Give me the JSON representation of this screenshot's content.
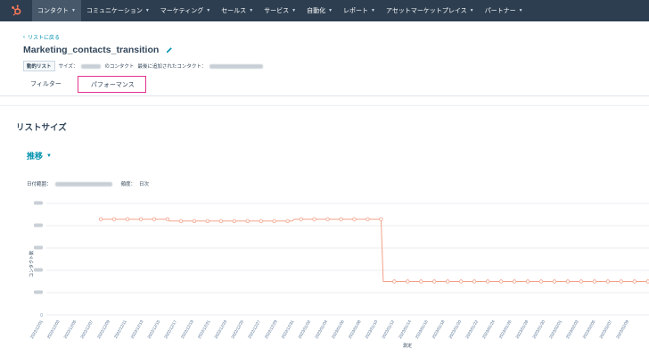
{
  "nav": {
    "items": [
      {
        "label": "コンタクト",
        "active": true
      },
      {
        "label": "コミュニケーション",
        "active": false
      },
      {
        "label": "マーケティング",
        "active": false
      },
      {
        "label": "セールス",
        "active": false
      },
      {
        "label": "サービス",
        "active": false
      },
      {
        "label": "自動化",
        "active": false
      },
      {
        "label": "レポート",
        "active": false
      },
      {
        "label": "アセットマーケットプレイス",
        "active": false
      },
      {
        "label": "パートナー",
        "active": false
      }
    ]
  },
  "header": {
    "back_label": "リストに戻る",
    "title": "Marketing_contacts_transition",
    "list_type_badge": "動的リスト",
    "size_label": "サイズ：",
    "size_suffix": "のコンタクト",
    "last_added_label": "最後に追加されたコンタクト："
  },
  "tabs": [
    {
      "label": "フィルター"
    },
    {
      "label": "パフォーマンス"
    }
  ],
  "section_title": "リストサイズ",
  "trend_label": "推移",
  "filters": {
    "date_range_label": "日付範囲：",
    "frequency_label": "頻度：",
    "frequency_value": "日次"
  },
  "colors": {
    "nav_bg": "#2d3e50",
    "accent": "#0091ae",
    "series": "#f2a189",
    "logo": "#ff7a59",
    "highlight_box": "#e2358d"
  },
  "chart_data": {
    "type": "line",
    "title": "",
    "xlabel": "測定",
    "ylabel": "コンタクト数",
    "y_tick_labels": [
      "0"
    ],
    "grid": true,
    "x_tick_labels": [
      "2022/12/01",
      "2022/12/03",
      "2022/12/05",
      "2022/12/07",
      "2022/12/09",
      "2022/12/11",
      "2022/12/13",
      "2022/12/15",
      "2022/12/17",
      "2022/12/19",
      "2022/12/21",
      "2022/12/23",
      "2022/12/25",
      "2022/12/27",
      "2022/12/29",
      "2022/12/31",
      "2023/01/02",
      "2023/01/04",
      "2023/01/06",
      "2023/01/08",
      "2023/01/10",
      "2023/01/12",
      "2023/01/14",
      "2023/01/16",
      "2023/01/18",
      "2023/01/20",
      "2023/01/22",
      "2023/01/24",
      "2023/01/26",
      "2023/01/28",
      "2023/01/30",
      "2023/02/01",
      "2023/02/03",
      "2023/02/05",
      "2023/02/07",
      "2023/02/09"
    ],
    "series": [
      {
        "values": [
          null,
          null,
          null,
          null,
          null,
          null,
          null,
          null,
          null,
          null,
          null,
          null,
          null,
          null,
          null,
          null,
          null,
          null,
          null,
          null,
          null,
          null,
          null,
          null,
          5.15,
          5.15,
          5.15,
          5.15,
          5.15,
          5.15,
          5.15,
          5.15,
          5.15,
          5.15,
          5.15,
          5.15,
          5.15,
          5.15,
          5.15,
          5.15,
          5.15,
          5.15,
          5.15,
          5.15,
          5.15,
          5.15,
          5.15,
          5.15,
          5.15,
          5.15,
          5.15,
          5.15,
          5.15,
          5.15,
          5.15,
          5.05,
          5.05,
          5.05,
          5.05,
          5.05,
          5.05,
          5.05,
          5.05,
          5.05,
          5.05,
          5.05,
          5.05,
          5.05,
          5.05,
          5.05,
          5.05,
          5.05,
          5.05,
          5.05,
          5.05,
          5.05,
          5.05,
          5.05,
          5.05,
          5.05,
          5.05,
          5.05,
          5.05,
          5.05,
          5.05,
          5.05,
          5.05,
          5.05,
          5.05,
          5.05,
          5.05,
          5.05,
          5.05,
          5.05,
          5.05,
          5.05,
          5.05,
          5.05,
          5.05,
          5.05,
          5.05,
          5.05,
          5.05,
          5.05,
          5.05,
          5.05,
          5.05,
          5.05,
          5.05,
          5.05,
          5.05,
          5.15,
          5.15,
          5.15,
          5.15,
          5.15,
          5.15,
          5.15,
          5.15,
          5.15,
          5.15,
          5.15,
          5.15,
          5.15,
          5.15,
          5.15,
          5.15,
          5.15,
          5.15,
          5.15,
          5.15,
          5.15,
          5.15,
          5.15,
          5.15,
          5.15,
          5.15,
          5.15,
          5.15,
          5.15,
          5.15,
          5.15,
          5.15,
          5.15,
          5.15,
          5.15,
          5.15,
          5.15,
          5.15,
          5.15,
          5.15,
          1.8,
          1.8,
          1.8,
          1.8,
          1.8,
          1.8,
          1.8,
          1.8,
          1.8,
          1.8,
          1.8,
          1.8,
          1.8,
          1.8,
          1.8,
          1.8,
          1.8,
          1.8,
          1.8,
          1.8,
          1.8,
          1.8,
          1.8,
          1.8,
          1.8,
          1.8,
          1.8,
          1.8,
          1.8,
          1.8,
          1.8,
          1.8,
          1.8,
          1.8,
          1.8,
          1.8,
          1.8,
          1.8,
          1.8,
          1.8,
          1.8,
          1.8,
          1.8,
          1.8,
          1.8,
          1.8,
          1.8,
          1.8,
          1.8,
          1.8,
          1.8,
          1.8,
          1.8,
          1.8,
          1.8,
          1.8,
          1.8,
          1.8,
          1.8,
          1.8,
          1.8,
          1.8,
          1.8,
          1.8,
          1.8,
          1.8,
          1.8,
          1.8,
          1.8,
          1.8,
          1.8,
          1.8,
          1.8,
          1.8,
          1.8,
          1.8,
          1.8,
          1.8,
          1.8,
          1.8,
          1.8,
          1.8,
          1.8,
          1.8,
          1.8,
          1.8,
          1.8,
          1.8,
          1.8,
          1.8,
          1.8,
          1.8,
          1.8,
          1.8,
          1.8,
          1.8,
          1.8,
          1.8,
          1.8,
          1.8,
          1.8,
          1.8,
          1.8,
          1.8,
          1.8,
          1.8,
          1.8,
          1.8,
          1.8,
          1.8,
          1.8,
          1.8,
          1.8,
          1.8,
          1.8,
          1.8,
          1.8,
          1.8,
          1.8,
          1.8
        ]
      }
    ],
    "y_range": [
      0,
      6
    ]
  }
}
